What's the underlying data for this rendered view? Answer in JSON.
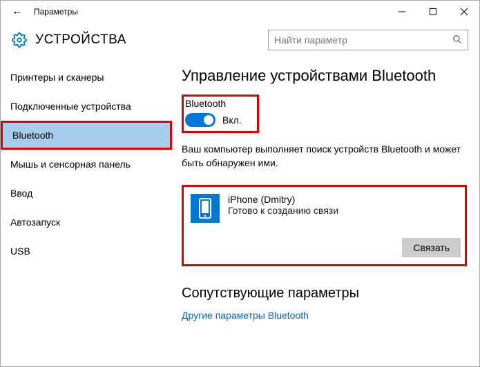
{
  "window": {
    "title": "Параметры",
    "min": "—",
    "max": "☐",
    "close": "✕",
    "back": "←"
  },
  "header": {
    "title": "УСТРОЙСТВА",
    "search_placeholder": "Найти параметр"
  },
  "sidebar": {
    "items": [
      "Принтеры и сканеры",
      "Подключенные устройства",
      "Bluetooth",
      "Мышь и сенсорная панель",
      "Ввод",
      "Автозапуск",
      "USB"
    ],
    "selected_index": 2
  },
  "main": {
    "title": "Управление устройствами Bluetooth",
    "toggle_label": "Bluetooth",
    "toggle_state": "Вкл.",
    "description": "Ваш компьютер выполняет поиск устройств Bluetooth и может быть обнаружен ими.",
    "device": {
      "name": "iPhone (Dmitry)",
      "status": "Готово к созданию связи",
      "pair_label": "Связать"
    },
    "related_heading": "Сопутствующие параметры",
    "related_link": "Другие параметры Bluetooth"
  }
}
